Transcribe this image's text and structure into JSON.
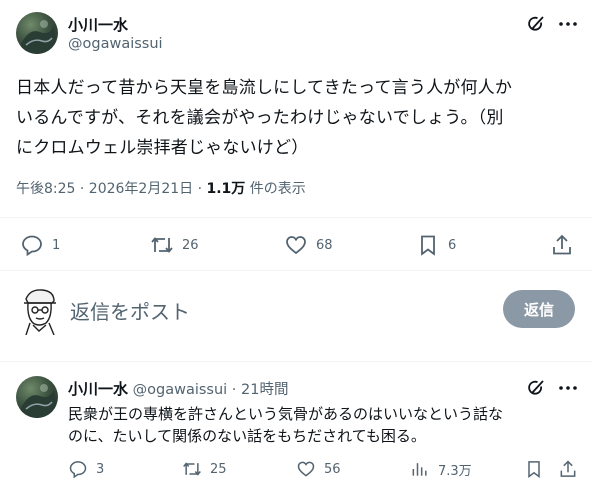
{
  "main_tweet": {
    "author_name": "小川一水",
    "handle": "@ogawaissui",
    "text_lines": [
      "日本人だって昔から天皇を島流しにしてきたって言う人が何人か",
      "いるんですが、それを議会がやったわけじゃないでしょう。（別",
      "にクロムウェル崇拝者じゃないけど）"
    ],
    "time": "午後8:25 · 2026年2月21日 · ",
    "views_count": "1.1万",
    "views_label": " 件の表示",
    "actions": {
      "replies": "1",
      "reposts": "26",
      "likes": "68",
      "bookmarks": "6"
    }
  },
  "composer": {
    "placeholder": "返信をポスト",
    "button_label": "返信"
  },
  "reply": {
    "author_name": "小川一水",
    "handle": "@ogawaissui",
    "separator": "·",
    "time": "21時間",
    "text_lines": [
      "民衆が王の専横を許さんという気骨があるのはいいなという話な",
      "のに、たいして関係のない話をもちだされても困る。"
    ],
    "actions": {
      "replies": "3",
      "reposts": "25",
      "likes": "56",
      "views": "7.3万"
    }
  },
  "icons": [
    "grok-icon",
    "more-icon",
    "reply-icon",
    "repost-icon",
    "like-icon",
    "bookmark-icon",
    "share-icon",
    "views-icon"
  ],
  "colors": {
    "text": "#0f1419",
    "secondary": "#536471",
    "reply_button": "#8b98a5",
    "divider": "#eff3f4"
  }
}
